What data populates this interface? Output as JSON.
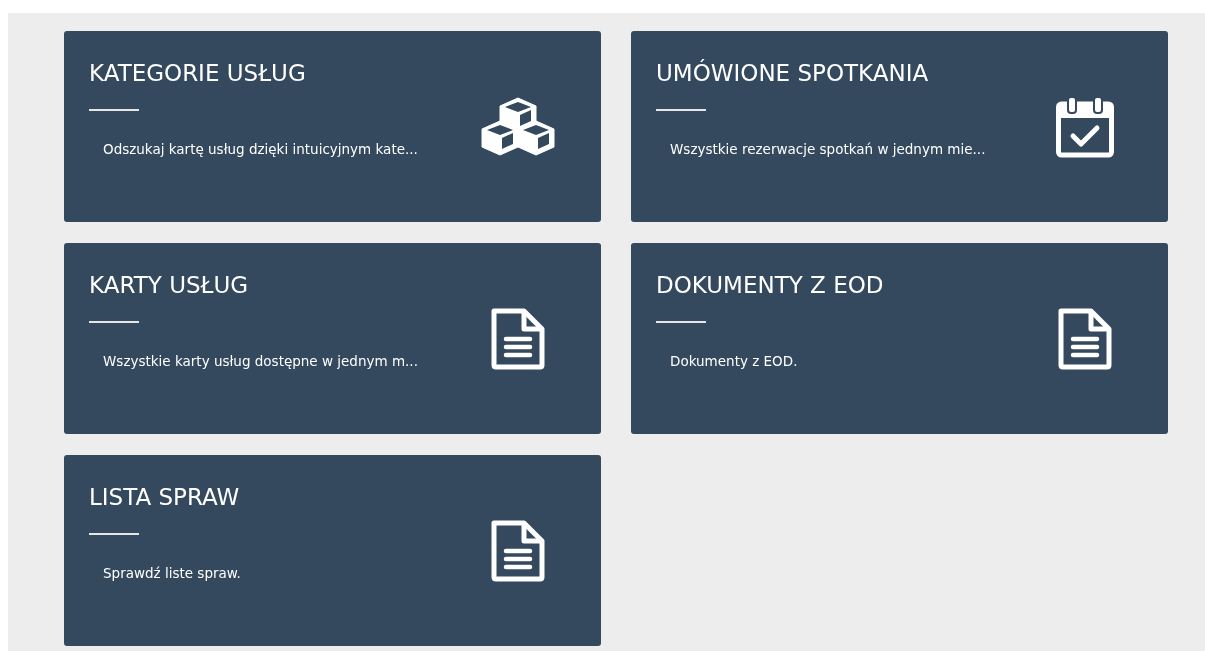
{
  "tiles": [
    {
      "title": "KATEGORIE USŁUG",
      "description": "Odszukaj kartę usług dzięki intuicyjnym kate...",
      "kind": "categories"
    },
    {
      "title": "UMÓWIONE SPOTKANIA",
      "description": "Wszystkie rezerwacje spotkań w jednym mie...",
      "kind": "appointments"
    },
    {
      "title": "KARTY USŁUG",
      "description": "Wszystkie karty usług dostępne w jednym m...",
      "kind": "document"
    },
    {
      "title": "DOKUMENTY Z EOD",
      "description": "Dokumenty z EOD.",
      "kind": "document"
    },
    {
      "title": "LISTA SPRAW",
      "description": "Sprawdź liste spraw.",
      "kind": "document"
    }
  ]
}
